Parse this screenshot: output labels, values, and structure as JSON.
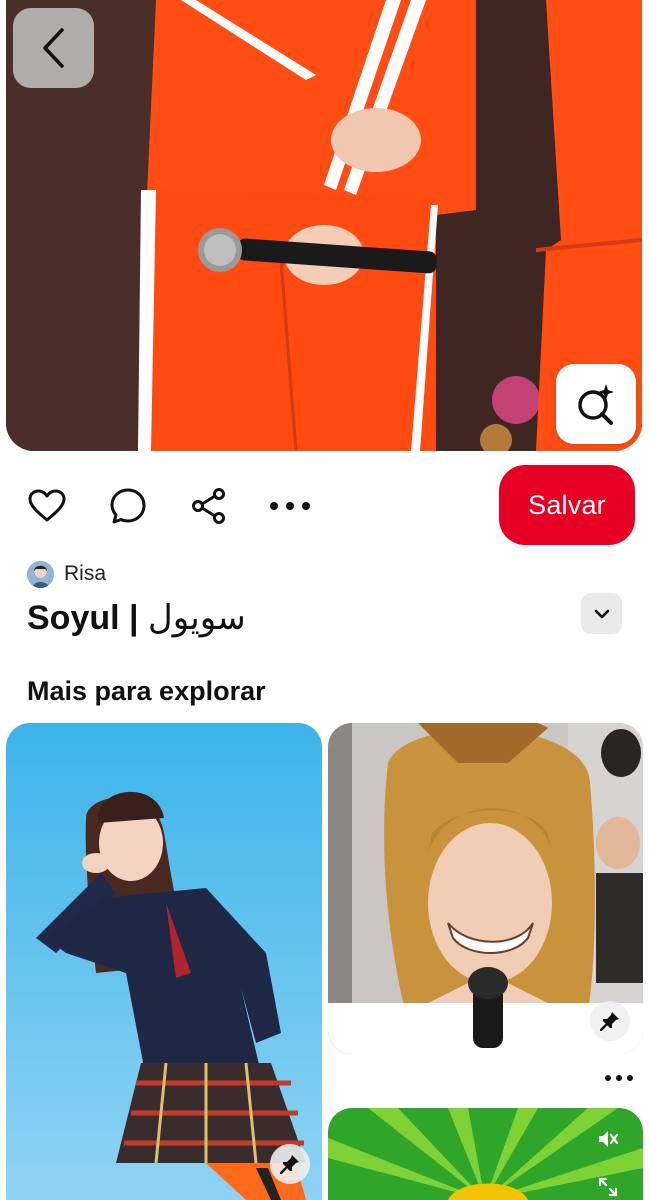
{
  "pin": {
    "author_name": "Risa",
    "title_latin": "Soyul | ",
    "title_arabic": "سويول"
  },
  "actions": {
    "save_label": "Salvar"
  },
  "explore": {
    "section_title": "Mais para explorar"
  },
  "icons": {
    "back": "chevron-left-icon",
    "visual_search": "visual-search-icon",
    "like": "heart-icon",
    "comment": "comment-icon",
    "share": "share-icon",
    "more": "more-horizontal-icon",
    "expand": "chevron-down-icon",
    "pin": "pushpin-icon",
    "mute": "speaker-muted-icon",
    "fullscreen": "expand-arrows-icon"
  },
  "colors": {
    "accent": "#e60023",
    "tracksuit": "#ff4a12"
  }
}
